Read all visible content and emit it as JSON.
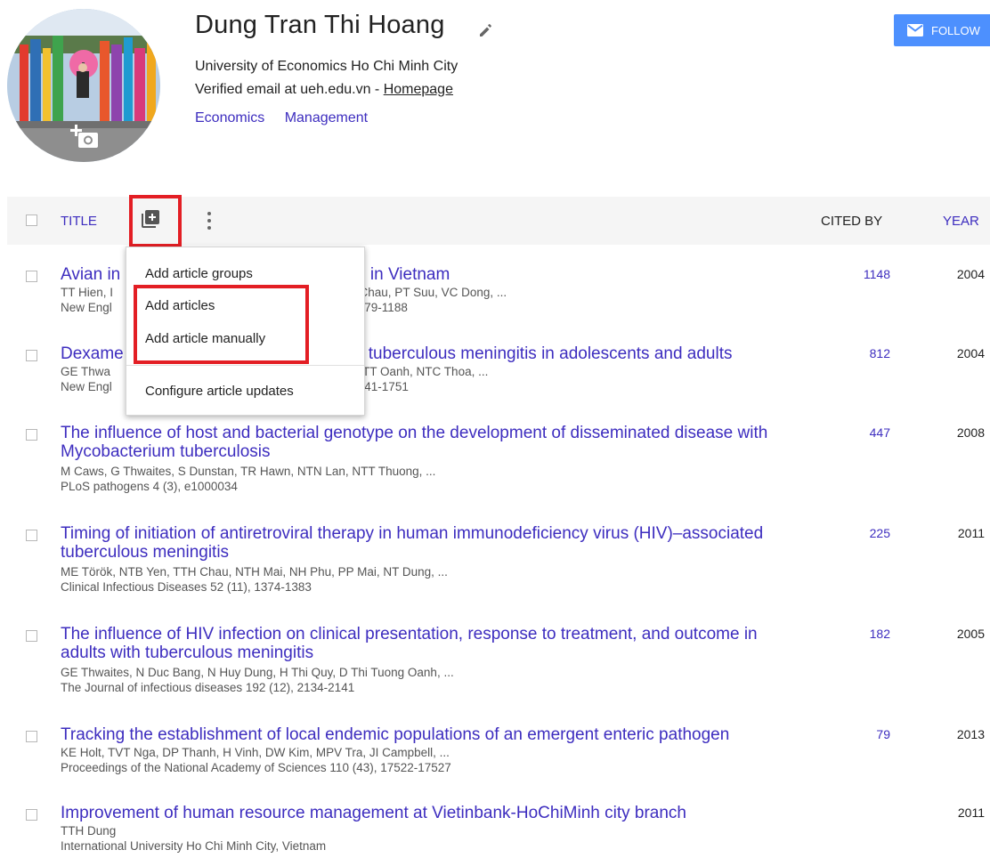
{
  "profile": {
    "name": "Dung Tran Thi Hoang",
    "affiliation": "University of Economics Ho Chi Minh City",
    "email_prefix": "Verified email at ueh.edu.vn - ",
    "homepage_label": "Homepage",
    "interests": [
      "Economics",
      "Management"
    ],
    "follow_label": "FOLLOW",
    "icons": {
      "edit": "pencil-icon",
      "camera": "add-photo-icon",
      "follow": "mail-icon"
    }
  },
  "table": {
    "title_header": "TITLE",
    "cited_header": "CITED BY",
    "year_header": "YEAR",
    "icons": {
      "add": "add-box-icon",
      "more": "more-vert-icon"
    }
  },
  "menu": {
    "items": [
      "Add article groups",
      "Add articles",
      "Add article manually",
      "Configure article updates"
    ]
  },
  "articles": [
    {
      "title": "Avian influenza A (H5N1) in 10 patients in Vietnam",
      "title_left": "Avian in",
      "title_right": "nts in Vietnam",
      "authors_left": "TT Hien, I",
      "authors_right": "NV Chau, PT Suu, VC Dong, ...",
      "venue_left": "New Engl",
      "venue_right": "179-1188",
      "cited": "1148",
      "year": "2004"
    },
    {
      "title_left": "Dexame",
      "title_right": "tuberculous meningitis in adolescents and adults",
      "authors_left": "GE Thwa",
      "authors_right": "TT Oanh, NTC Thoa, ...",
      "venue_left": "New Engl",
      "venue_right": "741-1751",
      "cited": "812",
      "year": "2004"
    },
    {
      "title": "The influence of host and bacterial genotype on the development of disseminated disease with Mycobacterium tuberculosis",
      "authors": "M Caws, G Thwaites, S Dunstan, TR Hawn, NTN Lan, NTT Thuong, ...",
      "venue": "PLoS pathogens 4 (3), e1000034",
      "cited": "447",
      "year": "2008"
    },
    {
      "title": "Timing of initiation of antiretroviral therapy in human immunodeficiency virus (HIV)–associated tuberculous meningitis",
      "authors": "ME Török, NTB Yen, TTH Chau, NTH Mai, NH Phu, PP Mai, NT Dung, ...",
      "venue": "Clinical Infectious Diseases 52 (11), 1374-1383",
      "cited": "225",
      "year": "2011"
    },
    {
      "title": "The influence of HIV infection on clinical presentation, response to treatment, and outcome in adults with tuberculous meningitis",
      "authors": "GE Thwaites, N Duc Bang, N Huy Dung, H Thi Quy, D Thi Tuong Oanh, ...",
      "venue": "The Journal of infectious diseases 192 (12), 2134-2141",
      "cited": "182",
      "year": "2005"
    },
    {
      "title": "Tracking the establishment of local endemic populations of an emergent enteric pathogen",
      "authors": "KE Holt, TVT Nga, DP Thanh, H Vinh, DW Kim, MPV Tra, JI Campbell, ...",
      "venue": "Proceedings of the National Academy of Sciences 110 (43), 17522-17527",
      "cited": "79",
      "year": "2013"
    },
    {
      "title": "Improvement of human resource management at Vietinbank-HoChiMinh city branch",
      "authors": "TTH Dung",
      "venue": "International University Ho Chi Minh City, Vietnam",
      "cited": "",
      "year": "2011"
    }
  ]
}
